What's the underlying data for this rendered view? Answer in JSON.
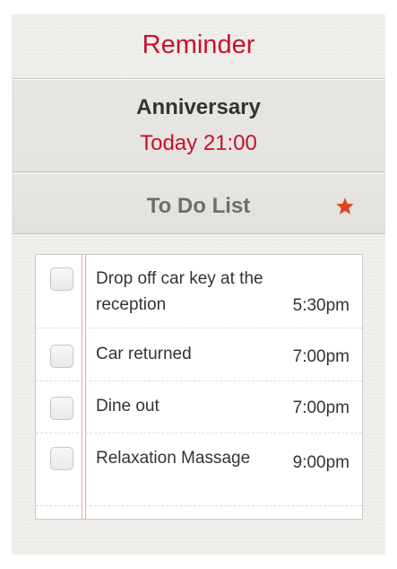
{
  "header": {
    "title": "Reminder"
  },
  "event": {
    "name": "Anniversary",
    "time": "Today 21:00"
  },
  "todo": {
    "title": "To Do List",
    "star_icon": "star-icon",
    "star_color": "#e0441d",
    "items": [
      {
        "text": "Drop off car key at the reception",
        "time": "5:30pm",
        "checked": false
      },
      {
        "text": "Car returned",
        "time": "7:00pm",
        "checked": false
      },
      {
        "text": "Dine out",
        "time": "7:00pm",
        "checked": false
      },
      {
        "text": "Relaxation Massage",
        "time": "9:00pm",
        "checked": false
      }
    ]
  },
  "colors": {
    "accent_red": "#c8102e",
    "background": "#eeede9"
  }
}
